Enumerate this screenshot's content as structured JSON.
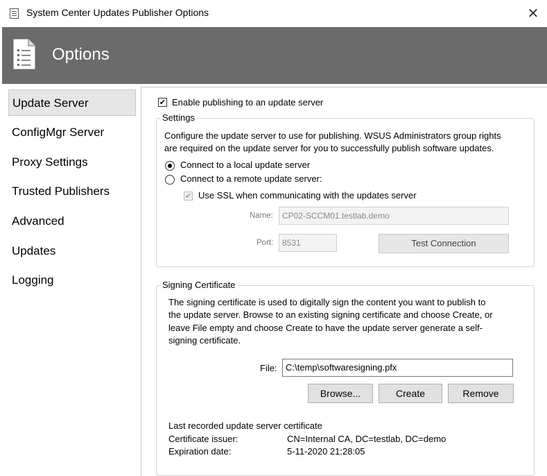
{
  "window": {
    "title": "System Center Updates Publisher Options",
    "close_symbol": "✕"
  },
  "header": {
    "title": "Options",
    "icon": "document-list-icon"
  },
  "sidebar": {
    "items": [
      {
        "label": "Update Server",
        "selected": true
      },
      {
        "label": "ConfigMgr Server",
        "selected": false
      },
      {
        "label": "Proxy Settings",
        "selected": false
      },
      {
        "label": "Trusted Publishers",
        "selected": false
      },
      {
        "label": "Advanced",
        "selected": false
      },
      {
        "label": "Updates",
        "selected": false
      },
      {
        "label": "Logging",
        "selected": false
      }
    ]
  },
  "update_server": {
    "enable_publishing": {
      "label": "Enable publishing to an update server",
      "checked": true
    },
    "settings": {
      "title": "Settings",
      "description_line1": "Configure the update server to use for publishing. WSUS Administrators group rights",
      "description_line2": "are required on the update server for you to successfully publish software updates.",
      "local_option": {
        "label": "Connect to a local update server",
        "selected": true
      },
      "remote_option": {
        "label": "Connect to a remote update server:",
        "selected": false
      },
      "use_ssl": {
        "label": "Use SSL when communicating with the updates server",
        "checked": true,
        "enabled": false
      },
      "name_label": "Name:",
      "name_value": "CP02-SCCM01.testlab.demo",
      "port_label": "Port:",
      "port_value": "8531",
      "test_connection_label": "Test Connection"
    },
    "signing_certificate": {
      "title": "Signing Certificate",
      "description_line1": "The signing certificate is used to digitally sign the content you want to publish to",
      "description_line2": "the update server. Browse to an existing signing certificate and choose Create, or",
      "description_line3": "leave File empty and choose Create to have the update server generate a self-",
      "description_line4": "signing certificate.",
      "file_label": "File:",
      "file_value": "C:\\temp\\softwaresigning.pfx",
      "browse_label": "Browse...",
      "create_label": "Create",
      "remove_label": "Remove",
      "last_recorded_label": "Last recorded update server certificate",
      "issuer_label": "Certificate issuer:",
      "issuer_value": "CN=Internal CA, DC=testlab, DC=demo",
      "expiration_label": "Expiration date:",
      "expiration_value": "5-11-2020 21:28:05"
    }
  },
  "colors": {
    "header_bg": "#6b6b6b",
    "selected_nav_bg": "#e6e6e6",
    "button_bg": "#e1e1e1"
  }
}
